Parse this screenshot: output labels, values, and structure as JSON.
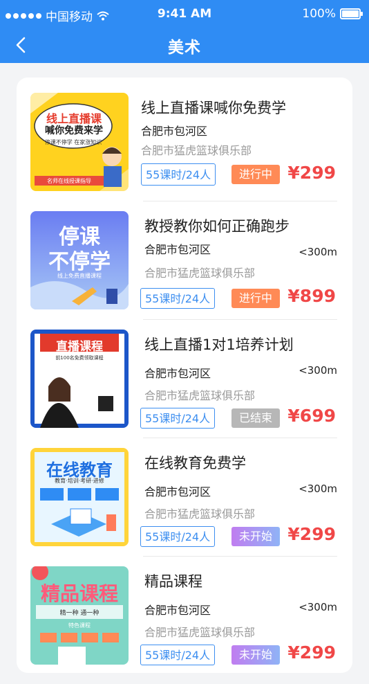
{
  "status_bar": {
    "carrier": "中国移动",
    "time": "9:41 AM",
    "battery": "100%"
  },
  "nav": {
    "title": "美术"
  },
  "colors": {
    "accent": "#2f8cf4",
    "price": "#f04747",
    "tag_orange": "#ff8a56",
    "tag_gray": "#b7b7b7",
    "tag_purple": "#b17bef"
  },
  "courses": [
    {
      "title": "线上直播课喊你免费学",
      "location": "合肥市包河区",
      "distance": "",
      "club": "合肥市猛虎篮球俱乐部",
      "lessons": "55课时/24人",
      "status": "进行中",
      "price": "¥299",
      "thumb": {
        "headline": "线上直播课",
        "line2": "喊你免费来学",
        "line3": "停课不停学 在家涨知识",
        "footer": "名师在线授课指导"
      }
    },
    {
      "title": "教授教你如何正确跑步",
      "location": "合肥市包河区",
      "distance": "<300m",
      "club": "合肥市猛虎篮球俱乐部",
      "lessons": "55课时/24人",
      "status": "进行中",
      "price": "¥899",
      "thumb": {
        "headline": "停课",
        "line2": "不停学",
        "line3": "线上免费直播课程"
      }
    },
    {
      "title": "线上直播1对1培养计划",
      "location": "合肥市包河区",
      "distance": "<300m",
      "club": "合肥市猛虎篮球俱乐部",
      "lessons": "55课时/24人",
      "status": "已结束",
      "price": "¥699",
      "thumb": {
        "headline": "直播课程",
        "line2": "前100名免费领取课程"
      }
    },
    {
      "title": "在线教育免费学",
      "location": "合肥市包河区",
      "distance": "<300m",
      "club": "合肥市猛虎篮球俱乐部",
      "lessons": "55课时/24人",
      "status": "未开始",
      "price": "¥299",
      "thumb": {
        "headline": "在线教育",
        "line2": "教育·培训·考研·进修"
      }
    },
    {
      "title": "精品课程",
      "location": "合肥市包河区",
      "distance": "<300m",
      "club": "合肥市猛虎篮球俱乐部",
      "lessons": "55课时/24人",
      "status": "未开始",
      "price": "¥299",
      "thumb": {
        "headline": "精品课程",
        "line2": "精一种 通一种",
        "line3": "特色课程"
      }
    }
  ]
}
